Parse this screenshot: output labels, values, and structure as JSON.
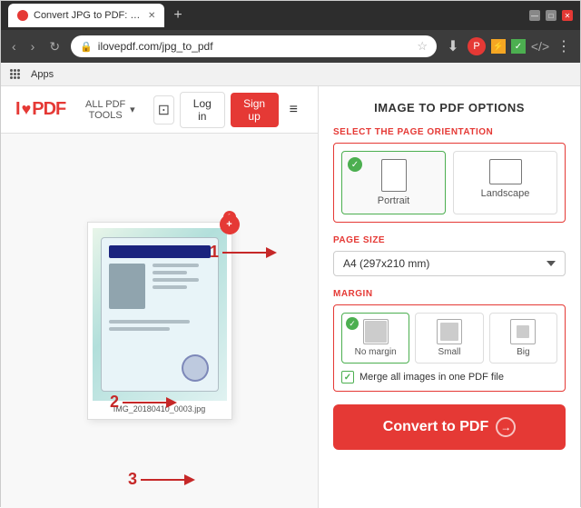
{
  "browser": {
    "tab_title": "Convert JPG to PDF: Images JPG",
    "address": "ilovepdf.com/jpg_to_pdf",
    "bookmarks_label": "Apps"
  },
  "header": {
    "logo_i": "I",
    "logo_heart": "♥",
    "logo_pdf": "PDF",
    "all_tools_label": "ALL PDF TOOLS",
    "monitor_icon": "⊡",
    "login_label": "Log in",
    "signup_label": "Sign up",
    "hamburger": "≡"
  },
  "main": {
    "options_title": "IMAGE TO PDF OPTIONS",
    "orientation_section_label": "SELECT THE PAGE ORIENTATION",
    "orientation_portrait_label": "Portrait",
    "orientation_landscape_label": "Landscape",
    "page_size_label": "PAGE SIZE",
    "page_size_value": "A4 (297x210 mm)",
    "margin_label": "MARGIN",
    "margin_no_label": "No margin",
    "margin_small_label": "Small",
    "margin_big_label": "Big",
    "merge_label": "Merge all images in one PDF file",
    "convert_btn_label": "Convert to PDF",
    "convert_icon": "→",
    "image_filename": "IMG_20180410_0003.jpg"
  },
  "annotations": {
    "num1": "1",
    "num2": "2",
    "num3": "3",
    "badge_count": "1"
  }
}
